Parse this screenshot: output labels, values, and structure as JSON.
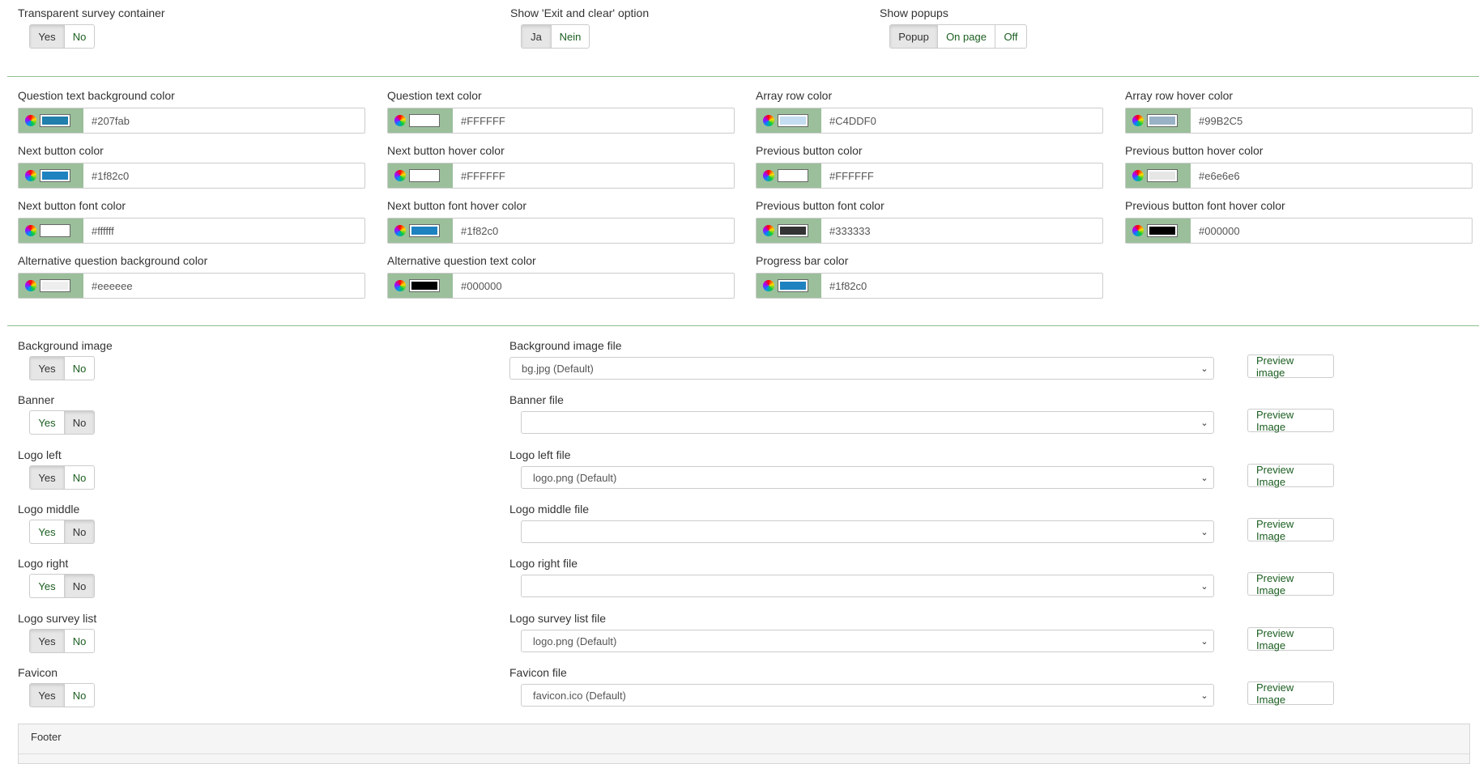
{
  "top_options": {
    "transparent": {
      "label": "Transparent survey container",
      "options": [
        "Yes",
        "No"
      ],
      "selected": "Yes"
    },
    "exit_clear": {
      "label": "Show 'Exit and clear' option",
      "options": [
        "Ja",
        "Nein"
      ],
      "selected": "Ja"
    },
    "popups": {
      "label": "Show popups",
      "options": [
        "Popup",
        "On page",
        "Off"
      ],
      "selected": "Popup"
    }
  },
  "colors": [
    {
      "label": "Question text background color",
      "value": "#207fab",
      "swatch": "#207fab"
    },
    {
      "label": "Question text color",
      "value": "#FFFFFF",
      "swatch": "#FFFFFF"
    },
    {
      "label": "Array row color",
      "value": "#C4DDF0",
      "swatch": "#C4DDF0"
    },
    {
      "label": "Array row hover color",
      "value": "#99B2C5",
      "swatch": "#99B2C5"
    },
    {
      "label": "Next button color",
      "value": "#1f82c0",
      "swatch": "#1f82c0"
    },
    {
      "label": "Next button hover color",
      "value": "#FFFFFF",
      "swatch": "#FFFFFF"
    },
    {
      "label": "Previous button color",
      "value": "#FFFFFF",
      "swatch": "#FFFFFF"
    },
    {
      "label": "Previous button hover color",
      "value": "#e6e6e6",
      "swatch": "#e6e6e6"
    },
    {
      "label": "Next button font color",
      "value": "#ffffff",
      "swatch": "#ffffff"
    },
    {
      "label": "Next button font hover color",
      "value": "#1f82c0",
      "swatch": "#1f82c0"
    },
    {
      "label": "Previous button font color",
      "value": "#333333",
      "swatch": "#333333"
    },
    {
      "label": "Previous button font hover color",
      "value": "#000000",
      "swatch": "#000000"
    },
    {
      "label": "Alternative question background color",
      "value": "#eeeeee",
      "swatch": "#eeeeee"
    },
    {
      "label": "Alternative question text color",
      "value": "#000000",
      "swatch": "#000000"
    },
    {
      "label": "Progress bar color",
      "value": "#1f82c0",
      "swatch": "#1f82c0"
    }
  ],
  "images": [
    {
      "toggle_label": "Background image",
      "selected": "Yes",
      "file_label": "Background image file",
      "file_value": "bg.jpg (Default)",
      "preview_label": "Preview image"
    },
    {
      "toggle_label": "Banner",
      "selected": "No",
      "file_label": "Banner file",
      "file_value": "",
      "preview_label": "Preview Image"
    },
    {
      "toggle_label": "Logo left",
      "selected": "Yes",
      "file_label": "Logo left file",
      "file_value": "logo.png (Default)",
      "preview_label": "Preview Image"
    },
    {
      "toggle_label": "Logo middle",
      "selected": "No",
      "file_label": "Logo middle file",
      "file_value": "",
      "preview_label": "Preview Image"
    },
    {
      "toggle_label": "Logo right",
      "selected": "No",
      "file_label": "Logo right file",
      "file_value": "",
      "preview_label": "Preview Image"
    },
    {
      "toggle_label": "Logo survey list",
      "selected": "Yes",
      "file_label": "Logo survey list file",
      "file_value": "logo.png (Default)",
      "preview_label": "Preview Image"
    },
    {
      "toggle_label": "Favicon",
      "selected": "Yes",
      "file_label": "Favicon file",
      "file_value": "favicon.ico (Default)",
      "preview_label": "Preview Image"
    }
  ],
  "yes_no": [
    "Yes",
    "No"
  ],
  "footer": {
    "title": "Footer"
  }
}
